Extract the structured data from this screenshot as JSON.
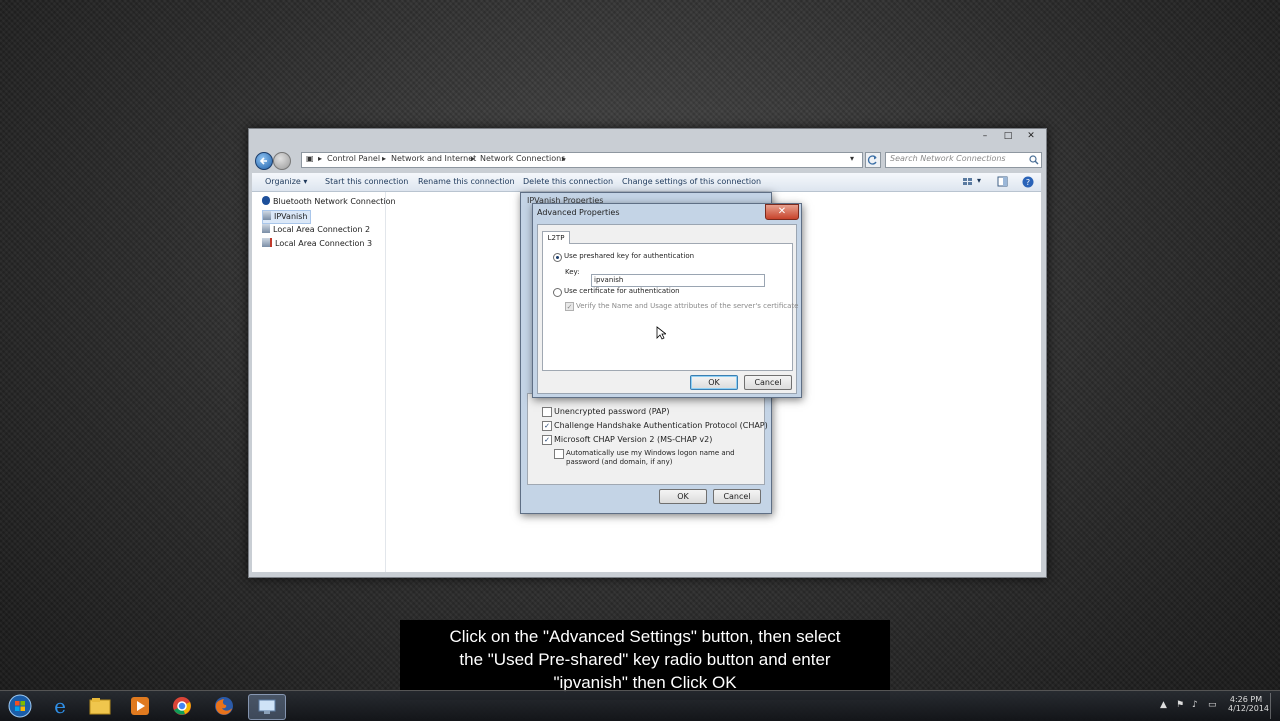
{
  "window": {
    "controls": {
      "minimize": "–",
      "maximize": "□",
      "close": "✕"
    },
    "address": {
      "root_icon": "network-folder-icon",
      "breadcrumb": [
        "Control Panel",
        "Network and Internet",
        "Network Connections"
      ],
      "search_placeholder": "Search Network Connections"
    },
    "commands": [
      "Organize ▾",
      "Start this connection",
      "Rename this connection",
      "Delete this connection",
      "Change settings of this connection"
    ],
    "connections": [
      {
        "label": "Bluetooth Network Connection",
        "icon": "bluetooth-icon"
      },
      {
        "label": "IPVanish",
        "icon": "vpn-connection-icon",
        "selected": true
      },
      {
        "label": "Local Area Connection 2",
        "icon": "network-adapter-icon"
      },
      {
        "label": "Local Area Connection 3",
        "icon": "network-adapter-icon"
      }
    ]
  },
  "ipvanish_dialog": {
    "title": "IPVanish Properties",
    "options": [
      {
        "label": "Unencrypted password (PAP)",
        "checked": false
      },
      {
        "label": "Challenge Handshake Authentication Protocol (CHAP)",
        "checked": true
      },
      {
        "label": "Microsoft CHAP Version 2 (MS-CHAP v2)",
        "checked": true
      }
    ],
    "sub_option": {
      "line1": "Automatically use my Windows logon name and",
      "line2": "password (and domain, if any)",
      "checked": false
    },
    "ok": "OK",
    "cancel": "Cancel"
  },
  "advanced_dialog": {
    "title": "Advanced Properties",
    "close": "✕",
    "tab": "L2TP",
    "preshared_label": "Use preshared key for authentication",
    "key_label": "Key:",
    "key_value": "ipvanish",
    "certificate_label": "Use certificate for authentication",
    "verify_label": "Verify the Name and Usage attributes of the server's certificate",
    "ok": "OK",
    "cancel": "Cancel"
  },
  "caption": {
    "line1": "Click on the \"Advanced Settings\" button, then select",
    "line2": "the \"Used Pre-shared\" key radio button and enter",
    "line3": "\"ipvanish\" then Click OK"
  },
  "taskbar": {
    "apps": [
      "start-orb-icon",
      "internet-explorer-icon",
      "file-explorer-icon",
      "media-player-icon",
      "chrome-icon",
      "firefox-icon",
      "network-connections-icon"
    ],
    "time": "4:26 PM",
    "date": "4/12/2014"
  }
}
